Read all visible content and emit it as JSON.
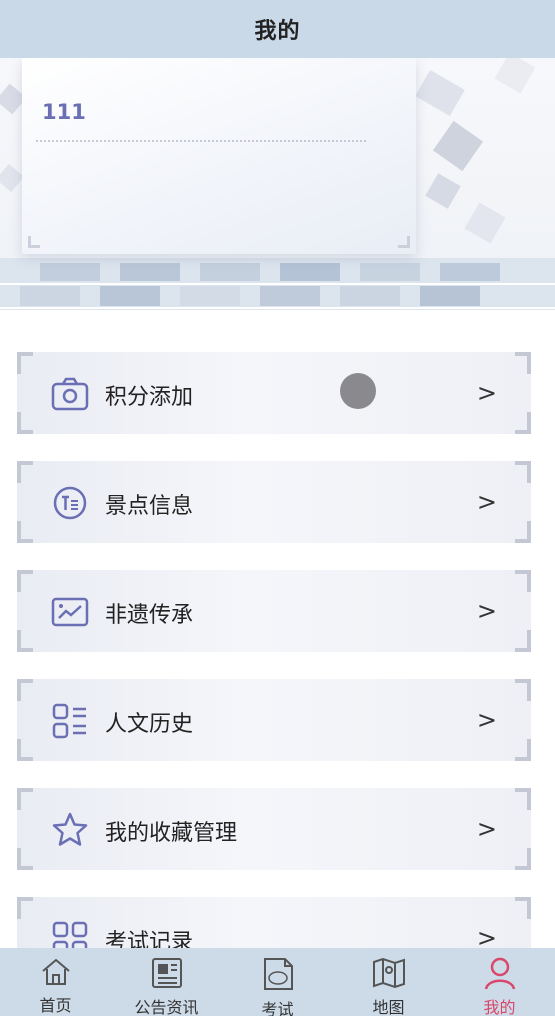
{
  "header": {
    "title": "我的"
  },
  "profile": {
    "username": "111"
  },
  "menu": {
    "items": [
      {
        "label": "积分添加",
        "icon": "camera-icon",
        "arrow": ">"
      },
      {
        "label": "景点信息",
        "icon": "text-circle-icon",
        "arrow": ">"
      },
      {
        "label": "非遗传承",
        "icon": "image-chart-icon",
        "arrow": ">"
      },
      {
        "label": "人文历史",
        "icon": "list-icon",
        "arrow": ">"
      },
      {
        "label": "我的收藏管理",
        "icon": "star-icon",
        "arrow": ">"
      },
      {
        "label": "考试记录",
        "icon": "grid-icon",
        "arrow": ">"
      }
    ]
  },
  "tabbar": {
    "items": [
      {
        "label": "首页",
        "icon": "home-icon"
      },
      {
        "label": "公告资讯",
        "icon": "news-icon"
      },
      {
        "label": "考试",
        "icon": "exam-icon"
      },
      {
        "label": "地图",
        "icon": "map-icon"
      },
      {
        "label": "我的",
        "icon": "person-icon",
        "active": true
      }
    ]
  },
  "colors": {
    "header_bg": "#c9d9e8",
    "icon_accent": "#6b6fb3",
    "active_tab": "#d9486a"
  }
}
